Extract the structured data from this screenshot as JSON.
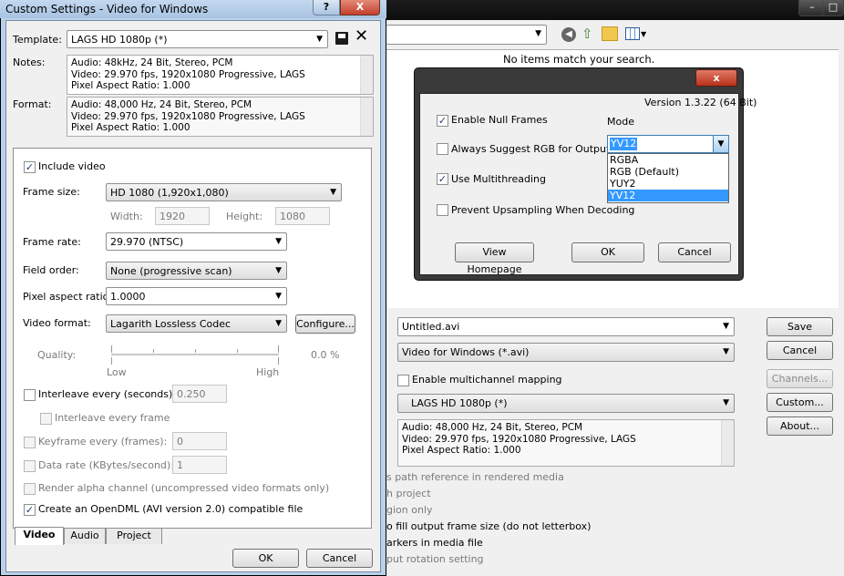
{
  "background_window": {
    "search_status": "No items match your search.",
    "filename": "Untitled.avi",
    "save_as_type": "Video for Windows (*.avi)",
    "multichannel_label": "Enable multichannel mapping",
    "template": "LAGS HD 1080p (*)",
    "description_lines": [
      "Audio: 48,000 Hz, 24 Bit, Stereo, PCM",
      "Video: 29.970 fps, 1920x1080 Progressive, LAGS",
      "Pixel Aspect Ratio: 1.000"
    ],
    "buttons": {
      "save": "Save",
      "cancel": "Cancel",
      "channels": "Channels...",
      "custom": "Custom...",
      "about": "About..."
    },
    "option_fragments": [
      "s path reference in rendered media",
      "h project",
      "gion only",
      "o fill output frame size (do not letterbox)",
      "arkers in media file",
      "put rotation setting"
    ]
  },
  "dialog": {
    "title": "Custom Settings - Video for Windows",
    "help_btn": "?",
    "close_btn": "X",
    "template_label": "Template:",
    "template_value": "LAGS HD 1080p (*)",
    "notes_label": "Notes:",
    "notes_lines": [
      "Audio: 48kHz, 24 Bit, Stereo, PCM",
      "Video: 29.970 fps, 1920x1080 Progressive, LAGS",
      "Pixel Aspect Ratio: 1.000"
    ],
    "format_label": "Format:",
    "format_lines": [
      "Audio: 48,000 Hz, 24 Bit, Stereo, PCM",
      "Video: 29.970 fps, 1920x1080 Progressive, LAGS",
      "Pixel Aspect Ratio: 1.000"
    ],
    "include_video": "Include video",
    "frame_size_label": "Frame size:",
    "frame_size_value": "HD 1080 (1,920x1,080)",
    "width_label": "Width:",
    "width_value": "1920",
    "height_label": "Height:",
    "height_value": "1080",
    "frame_rate_label": "Frame rate:",
    "frame_rate_value": "29.970 (NTSC)",
    "field_order_label": "Field order:",
    "field_order_value": "None (progressive scan)",
    "par_label": "Pixel aspect ratio:",
    "par_value": "1.0000",
    "video_format_label": "Video format:",
    "video_format_value": "Lagarith Lossless Codec",
    "configure_btn": "Configure...",
    "quality_label": "Quality:",
    "quality_value": "0.0 %",
    "quality_low": "Low",
    "quality_high": "High",
    "interleave_label": "Interleave every (seconds):",
    "interleave_value": "0.250",
    "interleave_frame_label": "Interleave every frame",
    "keyframe_label": "Keyframe every (frames):",
    "keyframe_value": "0",
    "datarate_label": "Data rate (KBytes/second):",
    "datarate_value": "1",
    "render_alpha_label": "Render alpha channel (uncompressed video formats only)",
    "opendml_label": "Create an OpenDML (AVI version 2.0) compatible file",
    "tabs": [
      "Video",
      "Audio",
      "Project"
    ],
    "ok": "OK",
    "cancel": "Cancel"
  },
  "lagarith": {
    "close_btn": "x",
    "version": "Version 1.3.22 (64 Bit)",
    "null_frames": "Enable Null Frames",
    "mode_label": "Mode",
    "suggest_rgb": "Always Suggest RGB for Output",
    "mode_value": "YV12",
    "mode_options": [
      "RGBA",
      "RGB (Default)",
      "YUY2",
      "YV12"
    ],
    "multithreading": "Use Multithreading",
    "prevent_upsampling": "Prevent Upsampling When Decoding",
    "homepage_btn": "View Homepage",
    "ok": "OK",
    "cancel": "Cancel"
  }
}
